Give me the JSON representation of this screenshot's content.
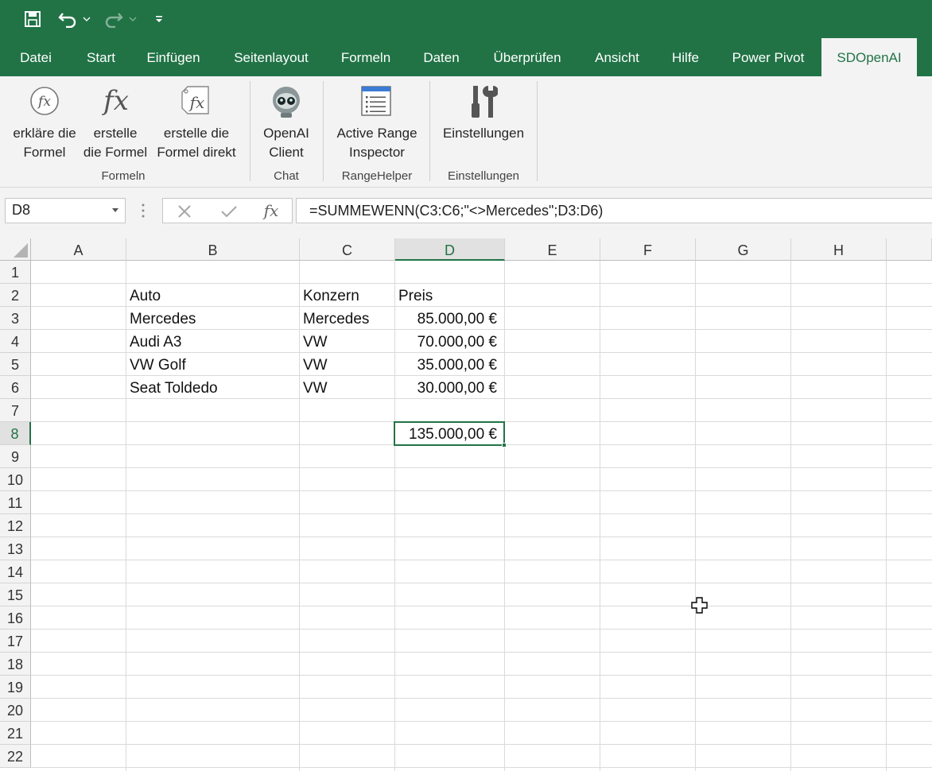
{
  "colors": {
    "accent": "#217346",
    "ribbon_bg": "#f3f3f3"
  },
  "qat": {
    "icons": [
      "save-icon",
      "undo-icon",
      "redo-icon",
      "customize-qat-icon"
    ]
  },
  "tabs": [
    "Datei",
    "Start",
    "Einfügen",
    "Seitenlayout",
    "Formeln",
    "Daten",
    "Überprüfen",
    "Ansicht",
    "Hilfe",
    "Power Pivot",
    "SDOpenAI"
  ],
  "active_tab": "SDOpenAI",
  "ribbon": {
    "groups": [
      {
        "label": "Formeln",
        "buttons": [
          {
            "label": "erkläre die\nFormel",
            "icon": "fx-circle-icon"
          },
          {
            "label": "erstelle\ndie Formel",
            "icon": "fx-icon"
          },
          {
            "label": "erstelle die\nFormel direkt",
            "icon": "fx-tag-icon"
          }
        ]
      },
      {
        "label": "Chat",
        "buttons": [
          {
            "label": "OpenAI\nClient",
            "icon": "robot-icon"
          }
        ]
      },
      {
        "label": "RangeHelper",
        "buttons": [
          {
            "label": "Active Range\nInspector",
            "icon": "list-window-icon"
          }
        ]
      },
      {
        "label": "Einstellungen",
        "buttons": [
          {
            "label": "Einstellungen",
            "icon": "tools-icon"
          }
        ]
      }
    ]
  },
  "formula_bar": {
    "name_box": "D8",
    "formula": "=SUMMEWENN(C3:C6;\"<>Mercedes\";D3:D6)"
  },
  "sheet": {
    "columns": [
      "A",
      "B",
      "C",
      "D",
      "E",
      "F",
      "G",
      "H"
    ],
    "rows": [
      "1",
      "2",
      "3",
      "4",
      "5",
      "6",
      "7",
      "8",
      "9",
      "10",
      "11",
      "12",
      "13",
      "14",
      "15",
      "16",
      "17",
      "18",
      "19",
      "20",
      "21",
      "22"
    ],
    "selected_column": "D",
    "selected_row": "8",
    "cells": {
      "B2": "Auto",
      "C2": "Konzern",
      "D2": "Preis",
      "B3": "Mercedes",
      "C3": "Mercedes",
      "D3": "85.000,00 €",
      "B4": "Audi A3",
      "C4": "VW",
      "D4": "70.000,00 €",
      "B5": "VW Golf",
      "C5": "VW",
      "D5": "35.000,00 €",
      "B6": "Seat Toldedo",
      "C6": "VW",
      "D6": "30.000,00 €",
      "D8": "135.000,00 €"
    }
  }
}
